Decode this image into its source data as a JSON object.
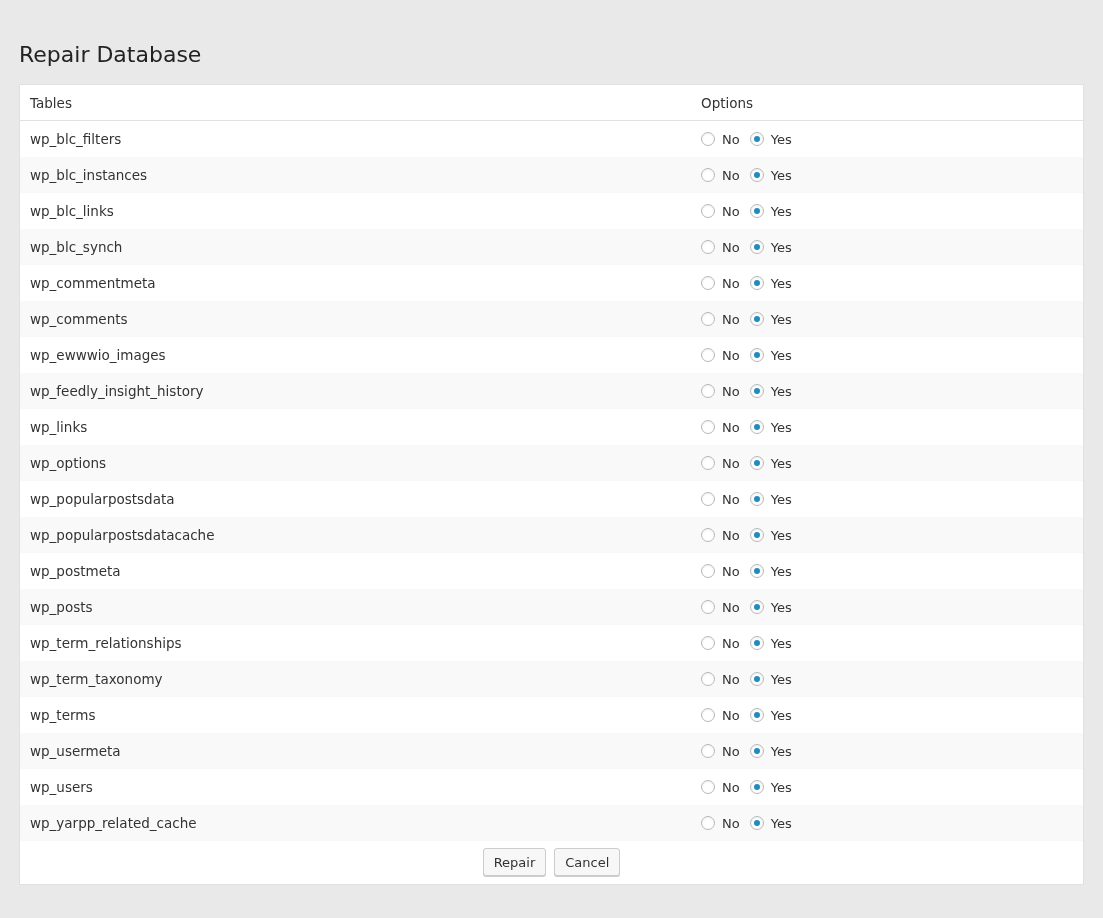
{
  "title": "Repair Database",
  "table": {
    "columns": [
      "Tables",
      "Options"
    ],
    "rows": [
      {
        "name": "wp_blc_filters",
        "options": [
          {
            "label": "No",
            "selected": false
          },
          {
            "label": "Yes",
            "selected": true
          }
        ]
      },
      {
        "name": "wp_blc_instances",
        "options": [
          {
            "label": "No",
            "selected": false
          },
          {
            "label": "Yes",
            "selected": true
          }
        ]
      },
      {
        "name": "wp_blc_links",
        "options": [
          {
            "label": "No",
            "selected": false
          },
          {
            "label": "Yes",
            "selected": true
          }
        ]
      },
      {
        "name": "wp_blc_synch",
        "options": [
          {
            "label": "No",
            "selected": false
          },
          {
            "label": "Yes",
            "selected": true
          }
        ]
      },
      {
        "name": "wp_commentmeta",
        "options": [
          {
            "label": "No",
            "selected": false
          },
          {
            "label": "Yes",
            "selected": true
          }
        ]
      },
      {
        "name": "wp_comments",
        "options": [
          {
            "label": "No",
            "selected": false
          },
          {
            "label": "Yes",
            "selected": true
          }
        ]
      },
      {
        "name": "wp_ewwwio_images",
        "options": [
          {
            "label": "No",
            "selected": false
          },
          {
            "label": "Yes",
            "selected": true
          }
        ]
      },
      {
        "name": "wp_feedly_insight_history",
        "options": [
          {
            "label": "No",
            "selected": false
          },
          {
            "label": "Yes",
            "selected": true
          }
        ]
      },
      {
        "name": "wp_links",
        "options": [
          {
            "label": "No",
            "selected": false
          },
          {
            "label": "Yes",
            "selected": true
          }
        ]
      },
      {
        "name": "wp_options",
        "options": [
          {
            "label": "No",
            "selected": false
          },
          {
            "label": "Yes",
            "selected": true
          }
        ]
      },
      {
        "name": "wp_popularpostsdata",
        "options": [
          {
            "label": "No",
            "selected": false
          },
          {
            "label": "Yes",
            "selected": true
          }
        ]
      },
      {
        "name": "wp_popularpostsdatacache",
        "options": [
          {
            "label": "No",
            "selected": false
          },
          {
            "label": "Yes",
            "selected": true
          }
        ]
      },
      {
        "name": "wp_postmeta",
        "options": [
          {
            "label": "No",
            "selected": false
          },
          {
            "label": "Yes",
            "selected": true
          }
        ]
      },
      {
        "name": "wp_posts",
        "options": [
          {
            "label": "No",
            "selected": false
          },
          {
            "label": "Yes",
            "selected": true
          }
        ]
      },
      {
        "name": "wp_term_relationships",
        "options": [
          {
            "label": "No",
            "selected": false
          },
          {
            "label": "Yes",
            "selected": true
          }
        ]
      },
      {
        "name": "wp_term_taxonomy",
        "options": [
          {
            "label": "No",
            "selected": false
          },
          {
            "label": "Yes",
            "selected": true
          }
        ]
      },
      {
        "name": "wp_terms",
        "options": [
          {
            "label": "No",
            "selected": false
          },
          {
            "label": "Yes",
            "selected": true
          }
        ]
      },
      {
        "name": "wp_usermeta",
        "options": [
          {
            "label": "No",
            "selected": false
          },
          {
            "label": "Yes",
            "selected": true
          }
        ]
      },
      {
        "name": "wp_users",
        "options": [
          {
            "label": "No",
            "selected": false
          },
          {
            "label": "Yes",
            "selected": true
          }
        ]
      },
      {
        "name": "wp_yarpp_related_cache",
        "options": [
          {
            "label": "No",
            "selected": false
          },
          {
            "label": "Yes",
            "selected": true
          }
        ]
      }
    ]
  },
  "buttons": [
    "Repair",
    "Cancel"
  ]
}
